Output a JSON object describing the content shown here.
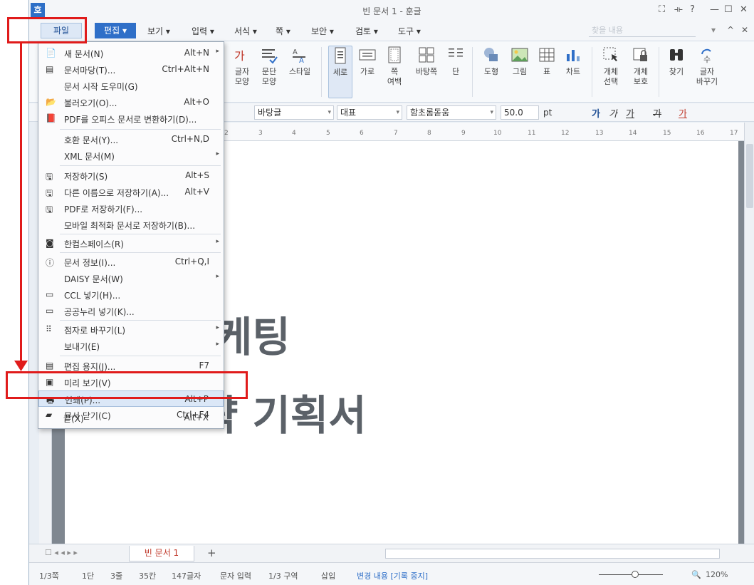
{
  "window": {
    "title": "빈 문서 1 - 훈글",
    "app_logo": "호",
    "controls": [
      "⛶",
      "⟛",
      "?",
      "—",
      "☐",
      "✕"
    ]
  },
  "menubar": {
    "file": "파일",
    "edit": "편집",
    "items": [
      "보기",
      "입력",
      "서식",
      "쪽",
      "보안",
      "검토",
      "도구"
    ],
    "search_placeholder": "찾을 내용",
    "right": [
      "▾",
      "^",
      "✕"
    ]
  },
  "ribbon": {
    "char_shape": "글자\n모양",
    "para_shape": "문단\n모양",
    "style": "스타일",
    "vertical": "세로",
    "horizontal": "가로",
    "page_margin": "쪽\n여백",
    "background": "바탕쪽",
    "columns": "단",
    "shape": "도형",
    "picture": "그림",
    "table": "표",
    "chart": "차트",
    "obj_select": "개체\n선택",
    "obj_protect": "개체\n보호",
    "find": "찾기",
    "replace": "글자\n바꾸기"
  },
  "format": {
    "style_value": "바탕글",
    "lang_value": "대표",
    "font_value": "함초롬돋움",
    "size_value": "50.0",
    "unit": "pt",
    "bold": "가",
    "italic": "가",
    "underline": "가",
    "strike": "가",
    "color": "가"
  },
  "ruler_numbers": [
    "2",
    "3",
    "4",
    "5",
    "6",
    "7",
    "8",
    "9",
    "10",
    "11",
    "12",
    "13",
    "14",
    "15",
    "16",
    "17"
  ],
  "document": {
    "line1": "케팅",
    "line2": "략 기획서"
  },
  "file_menu": [
    {
      "label": "새 문서(N)",
      "shortcut": "Alt+N",
      "arrow": "▸"
    },
    {
      "label": "문서마당(T)...",
      "shortcut": "Ctrl+Alt+N",
      "arrow": ""
    },
    {
      "label": "문서 시작 도우미(G)",
      "shortcut": "",
      "arrow": ""
    },
    {
      "label": "불러오기(O)...",
      "shortcut": "Alt+O",
      "arrow": ""
    },
    {
      "label": "PDF를 오피스 문서로 변환하기(D)...",
      "shortcut": "",
      "arrow": ""
    },
    {
      "label": "호환 문서(Y)...",
      "shortcut": "Ctrl+N,D",
      "arrow": ""
    },
    {
      "label": "XML 문서(M)",
      "shortcut": "",
      "arrow": "▸"
    },
    {
      "label": "저장하기(S)",
      "shortcut": "Alt+S",
      "arrow": ""
    },
    {
      "label": "다른 이름으로 저장하기(A)...",
      "shortcut": "Alt+V",
      "arrow": ""
    },
    {
      "label": "PDF로 저장하기(F)...",
      "shortcut": "",
      "arrow": ""
    },
    {
      "label": "모바일 최적화 문서로 저장하기(B)...",
      "shortcut": "",
      "arrow": ""
    },
    {
      "label": "한컴스페이스(R)",
      "shortcut": "",
      "arrow": "▸"
    },
    {
      "label": "문서 정보(I)...",
      "shortcut": "Ctrl+Q,I",
      "arrow": ""
    },
    {
      "label": "DAISY 문서(W)",
      "shortcut": "",
      "arrow": "▸"
    },
    {
      "label": "CCL 넣기(H)...",
      "shortcut": "",
      "arrow": ""
    },
    {
      "label": "공공누리 넣기(K)...",
      "shortcut": "",
      "arrow": ""
    },
    {
      "label": "점자로 바꾸기(L)",
      "shortcut": "",
      "arrow": "▸"
    },
    {
      "label": "보내기(E)",
      "shortcut": "",
      "arrow": "▸"
    },
    {
      "label": "편집 용지(J)...",
      "shortcut": "F7",
      "arrow": ""
    },
    {
      "label": "미리 보기(V)",
      "shortcut": "",
      "arrow": ""
    },
    {
      "label": "인쇄(P)...",
      "shortcut": "Alt+P",
      "arrow": ""
    },
    {
      "label": "문서 닫기(C)",
      "shortcut": "Ctrl+F4",
      "arrow": ""
    },
    {
      "label": "끝(X)",
      "shortcut": "Alt+X",
      "arrow": ""
    }
  ],
  "tabbar": {
    "doc_tab": "빈 문서 1",
    "add": "+"
  },
  "status": {
    "page": "1/3쪽",
    "col": "1단",
    "line": "3줄",
    "char": "35칸",
    "count": "147글자",
    "mode": "문자 입력",
    "section": "1/3 구역",
    "insert": "삽입",
    "track": "변경 내용 [기록 중지]",
    "zoom": "120%"
  },
  "colors": {
    "accent": "#2f6fc8",
    "annotation": "#e01b1b",
    "doc_text": "#5b6168"
  }
}
